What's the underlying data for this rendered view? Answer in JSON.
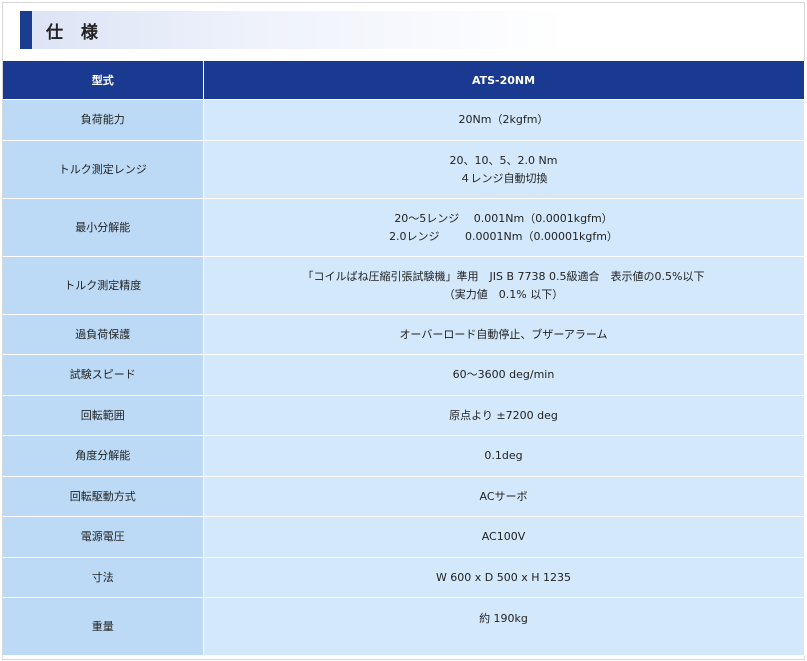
{
  "section_title": "仕 様",
  "table": {
    "header": {
      "label": "型式",
      "value": "ATS-20NM"
    },
    "rows": [
      {
        "label": "負荷能力",
        "lines": [
          "20Nm（2kgfm）"
        ]
      },
      {
        "label": "トルク測定レンジ",
        "lines": [
          "20、10、5、2.0 Nm",
          "４レンジ自動切換"
        ]
      },
      {
        "label": "最小分解能",
        "lines": [
          "20～5レンジ　 0.001Nm（0.0001kgfm）",
          "2.0レンジ　　 0.0001Nm（0.00001kgfm）"
        ]
      },
      {
        "label": "トルク測定精度",
        "lines": [
          "「コイルばね圧縮引張試験機」準用　JIS B 7738 0.5級適合　表示値の0.5%以下",
          "（実力値　0.1% 以下）"
        ]
      },
      {
        "label": "過負荷保護",
        "lines": [
          "オーバーロード自動停止、ブザーアラーム"
        ]
      },
      {
        "label": "試験スピード",
        "lines": [
          "60～3600 deg/min"
        ]
      },
      {
        "label": "回転範囲",
        "lines": [
          "原点より ±7200 deg"
        ]
      },
      {
        "label": "角度分解能",
        "lines": [
          "0.1deg"
        ]
      },
      {
        "label": "回転駆動方式",
        "lines": [
          "ACサーボ"
        ]
      },
      {
        "label": "電源電圧",
        "lines": [
          "AC100V"
        ]
      },
      {
        "label": "寸法",
        "lines": [
          "W 600 x D 500 x H 1235"
        ]
      },
      {
        "label": "重量",
        "lines": [
          "約 190kg"
        ]
      }
    ]
  }
}
